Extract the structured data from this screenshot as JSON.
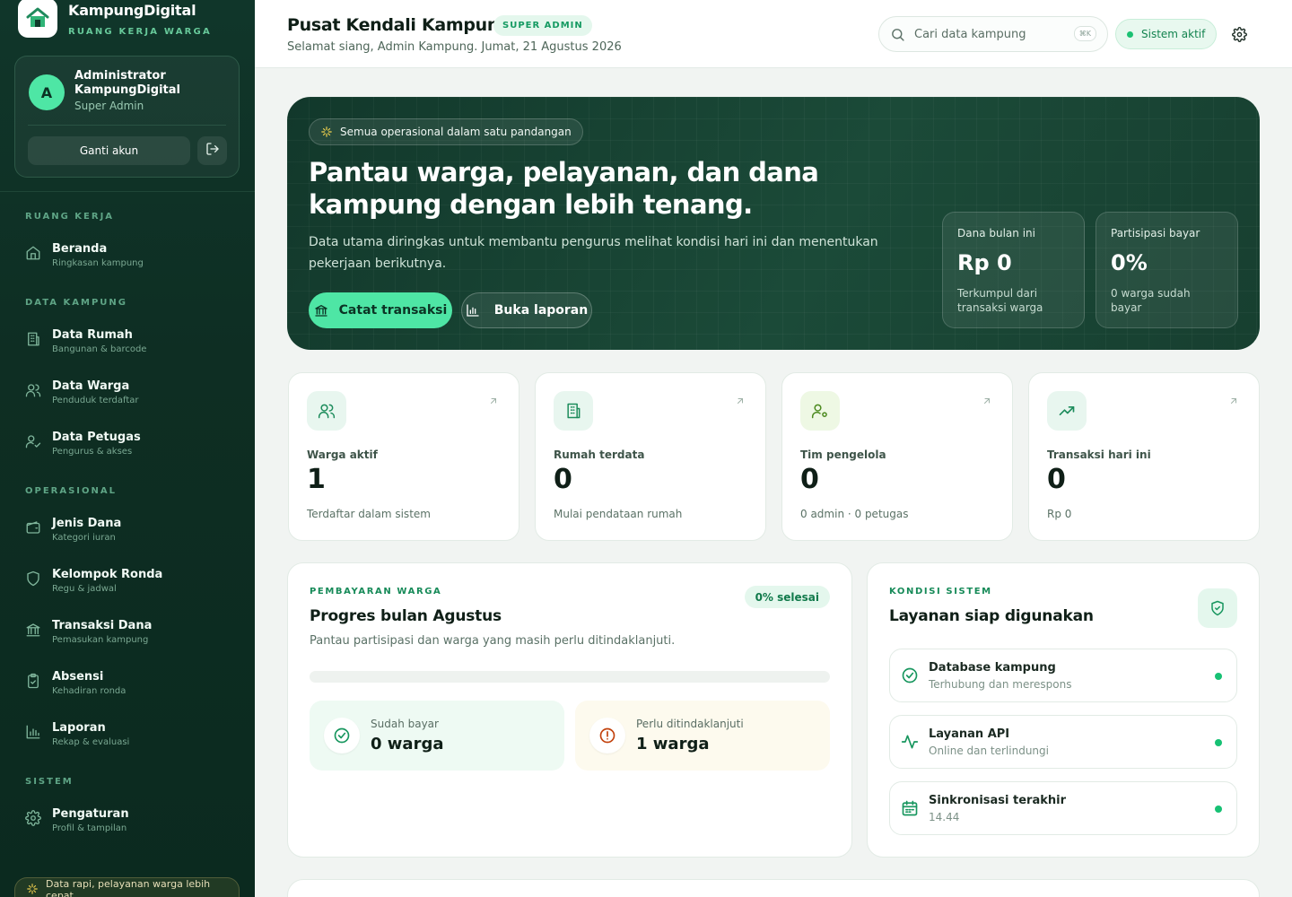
{
  "brand": {
    "name": "KampungDigital",
    "tagline": "RUANG KERJA WARGA"
  },
  "user": {
    "initial": "A",
    "name": "Administrator KampungDigital",
    "role": "Super Admin",
    "switch_label": "Ganti akun"
  },
  "nav": {
    "sections": [
      {
        "title": "RUANG KERJA",
        "items": [
          {
            "label": "Beranda",
            "sub": "Ringkasan kampung",
            "icon": "home-icon"
          }
        ]
      },
      {
        "title": "DATA KAMPUNG",
        "items": [
          {
            "label": "Data Rumah",
            "sub": "Bangunan & barcode",
            "icon": "building-icon"
          },
          {
            "label": "Data Warga",
            "sub": "Penduduk terdaftar",
            "icon": "users-icon"
          },
          {
            "label": "Data Petugas",
            "sub": "Pengurus & akses",
            "icon": "user-check-icon"
          }
        ]
      },
      {
        "title": "OPERASIONAL",
        "items": [
          {
            "label": "Jenis Dana",
            "sub": "Kategori iuran",
            "icon": "wallet-icon"
          },
          {
            "label": "Kelompok Ronda",
            "sub": "Regu & jadwal",
            "icon": "shield-icon"
          },
          {
            "label": "Transaksi Dana",
            "sub": "Pemasukan kampung",
            "icon": "bank-icon"
          },
          {
            "label": "Absensi",
            "sub": "Kehadiran ronda",
            "icon": "clipboard-check-icon"
          },
          {
            "label": "Laporan",
            "sub": "Rekap & evaluasi",
            "icon": "bar-chart-icon"
          }
        ]
      },
      {
        "title": "SISTEM",
        "items": [
          {
            "label": "Pengaturan",
            "sub": "Profil & tampilan",
            "icon": "gear-icon"
          }
        ]
      }
    ]
  },
  "sidebar_footer": "Data rapi, pelayanan warga lebih cepat.",
  "header": {
    "title": "Pusat Kendali Kampung",
    "badge": "SUPER ADMIN",
    "greeting": "Selamat siang, Admin Kampung. Jumat, 21 Agustus 2026",
    "search_placeholder": "Cari data kampung",
    "shortcut": "⌘K",
    "status": "Sistem aktif"
  },
  "hero": {
    "tag": "Semua operasional dalam satu pandangan",
    "title": "Pantau warga, pelayanan, dan dana kampung dengan lebih tenang.",
    "desc": "Data utama diringkas untuk membantu pengurus melihat kondisi hari ini dan menentukan pekerjaan berikutnya.",
    "primary": "Catat transaksi",
    "secondary": "Buka laporan",
    "stats": [
      {
        "label": "Dana bulan ini",
        "value": "Rp 0",
        "sub": "Terkumpul dari transaksi warga"
      },
      {
        "label": "Partisipasi bayar",
        "value": "0%",
        "sub": "0 warga sudah bayar"
      }
    ]
  },
  "stats": [
    {
      "label": "Warga aktif",
      "value": "1",
      "sub": "Terdaftar dalam sistem",
      "icon": "users-icon"
    },
    {
      "label": "Rumah terdata",
      "value": "0",
      "sub": "Mulai pendataan rumah",
      "icon": "building-icon"
    },
    {
      "label": "Tim pengelola",
      "value": "0",
      "sub": "0 admin · 0 petugas",
      "icon": "user-gear-icon"
    },
    {
      "label": "Transaksi hari ini",
      "value": "0",
      "sub": "Rp 0",
      "icon": "trending-up-icon"
    }
  ],
  "payments": {
    "eyebrow": "PEMBAYARAN WARGA",
    "title": "Progres bulan Agustus",
    "desc": "Pantau partisipasi dan warga yang masih perlu ditindaklanjuti.",
    "badge": "0% selesai",
    "progress": 0,
    "paid_label": "Sudah bayar",
    "paid_value": "0 warga",
    "pending_label": "Perlu ditindaklanjuti",
    "pending_value": "1 warga"
  },
  "system": {
    "eyebrow": "KONDISI SISTEM",
    "title": "Layanan siap digunakan",
    "services": [
      {
        "title": "Database kampung",
        "sub": "Terhubung dan merespons",
        "icon": "check-circle-icon"
      },
      {
        "title": "Layanan API",
        "sub": "Online dan terlindungi",
        "icon": "activity-icon"
      },
      {
        "title": "Sinkronisasi terakhir",
        "sub": "14.44",
        "icon": "calendar-icon"
      }
    ]
  },
  "colors": {
    "accent": "#4ee6a5",
    "sidebar": "#0e2e23",
    "success": "#17c174",
    "warning": "#c2410c"
  }
}
